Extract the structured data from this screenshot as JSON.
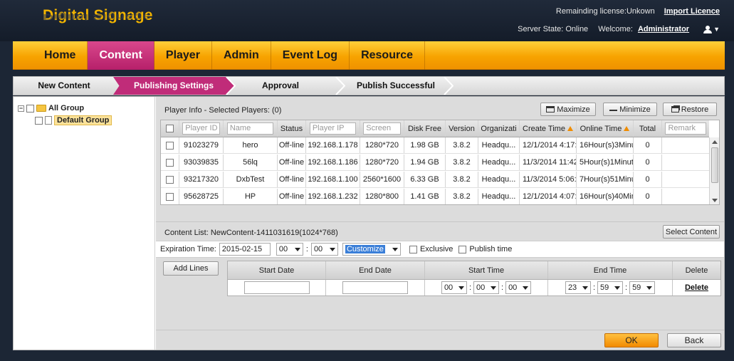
{
  "header": {
    "logo": "Digital Signage",
    "license_text": "Remainding license:Unkown",
    "import_licence": "Import Licence",
    "server_state": "Server State: Online",
    "welcome": "Welcome:",
    "user": "Administrator"
  },
  "nav": {
    "items": [
      "Home",
      "Content",
      "Player",
      "Admin",
      "Event Log",
      "Resource"
    ],
    "active": "Content"
  },
  "steps": [
    "New Content",
    "Publishing Settings",
    "Approval",
    "Publish Successful"
  ],
  "tree": {
    "root": "All Group",
    "child": "Default Group"
  },
  "player_info": {
    "title": "Player Info - Selected Players: (0)",
    "maximize": "Maximize",
    "minimize": "Minimize",
    "restore": "Restore",
    "columns": {
      "player_id": "Player ID",
      "name": "Name",
      "status": "Status",
      "player_ip": "Player IP",
      "screen": "Screen",
      "disk_free": "Disk Free",
      "version": "Version",
      "organization": "Organizati",
      "create_time": "Create Time",
      "online_time": "Online Time",
      "total": "Total",
      "remark": "Remark"
    },
    "rows": [
      {
        "id": "91023279",
        "name": "hero",
        "status": "Off-line",
        "ip": "192.168.1.178",
        "screen": "1280*720",
        "disk": "1.98 GB",
        "version": "3.8.2",
        "org": "Headqu...",
        "create": "12/1/2014 4:17:",
        "online": "16Hour(s)3Minu",
        "total": "0"
      },
      {
        "id": "93039835",
        "name": "56lq",
        "status": "Off-line",
        "ip": "192.168.1.186",
        "screen": "1280*720",
        "disk": "1.94 GB",
        "version": "3.8.2",
        "org": "Headqu...",
        "create": "11/3/2014 11:42",
        "online": "5Hour(s)1Minut",
        "total": "0"
      },
      {
        "id": "93217320",
        "name": "DxbTest",
        "status": "Off-line",
        "ip": "192.168.1.100",
        "screen": "2560*1600",
        "disk": "6.33 GB",
        "version": "3.8.2",
        "org": "Headqu...",
        "create": "11/3/2014 5:06:",
        "online": "7Hour(s)51Minu",
        "total": "0"
      },
      {
        "id": "95628725",
        "name": "HP",
        "status": "Off-line",
        "ip": "192.168.1.232",
        "screen": "1280*800",
        "disk": "1.41 GB",
        "version": "3.8.2",
        "org": "Headqu...",
        "create": "12/1/2014 4:07:",
        "online": "16Hour(s)40Min",
        "total": "0"
      }
    ]
  },
  "content_list": {
    "title": "Content List: NewContent-1411031619(1024*768)",
    "select_content": "Select Content"
  },
  "expiration": {
    "label": "Expiration Time:",
    "date": "2015-02-15",
    "hour": "00",
    "minute": "00",
    "mode": "Customize",
    "exclusive": "Exclusive",
    "publish_time": "Publish time"
  },
  "lines": {
    "add_lines": "Add Lines",
    "columns": [
      "Start Date",
      "End Date",
      "Start Time",
      "End Time",
      "Delete"
    ],
    "row": {
      "start_h": "00",
      "start_m": "00",
      "start_s": "00",
      "end_h": "23",
      "end_m": "59",
      "end_s": "59",
      "delete": "Delete"
    }
  },
  "buttons": {
    "ok": "OK",
    "back": "Back"
  },
  "colors": {
    "accent_orange": "#f7a300",
    "active_magenta": "#c02c79",
    "logo_gold": "#f2b400"
  }
}
